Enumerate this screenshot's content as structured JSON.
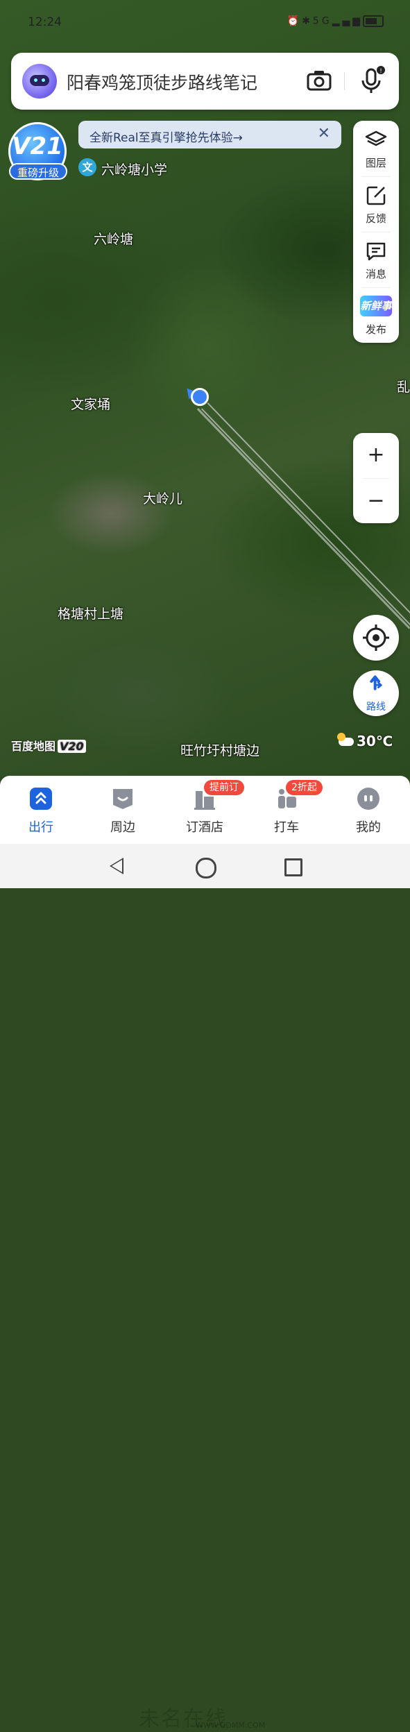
{
  "status_bar": {
    "time": "12:24",
    "network": "5G"
  },
  "search": {
    "placeholder": "阳春鸡笼顶徒步路线笔记"
  },
  "version_badge": {
    "version": "V21",
    "label": "重磅升级"
  },
  "promo_banner": {
    "text": "全新Real至真引擎抢先体验→",
    "close": "✕"
  },
  "right_toolbar": [
    {
      "label": "图层",
      "icon": "layers-icon"
    },
    {
      "label": "反馈",
      "icon": "feedback-edit-icon"
    },
    {
      "label": "消息",
      "icon": "message-icon"
    },
    {
      "label": "发布",
      "icon": "fresh-news-icon",
      "badge_text": "新鲜事"
    }
  ],
  "zoom": {
    "in": "+",
    "out": "−"
  },
  "route_button": {
    "label": "路线"
  },
  "map": {
    "places": [
      {
        "name": "六岭塘小学",
        "pin": "文"
      },
      {
        "name": "六岭塘"
      },
      {
        "name": "文家埇"
      },
      {
        "name": "大岭儿"
      },
      {
        "name": "格塘村上塘"
      },
      {
        "name": "旺竹圩村塘边"
      },
      {
        "name": "乱"
      }
    ],
    "logo": "百度地图",
    "logo_version": "V20",
    "weather": "30℃"
  },
  "bottom_nav": [
    {
      "label": "出行",
      "icon": "travel-icon",
      "active": true
    },
    {
      "label": "周边",
      "icon": "nearby-icon"
    },
    {
      "label": "订酒店",
      "icon": "hotel-icon",
      "tag": "提前订"
    },
    {
      "label": "打车",
      "icon": "taxi-icon",
      "tag": "2折起"
    },
    {
      "label": "我的",
      "icon": "profile-icon"
    }
  ],
  "watermark": {
    "text": "未名在线",
    "url": "WWW.GDMM.COM"
  },
  "colors": {
    "accent": "#1d63e0",
    "tag_red": "#ef4a3c",
    "location_blue": "#3b82f6"
  }
}
